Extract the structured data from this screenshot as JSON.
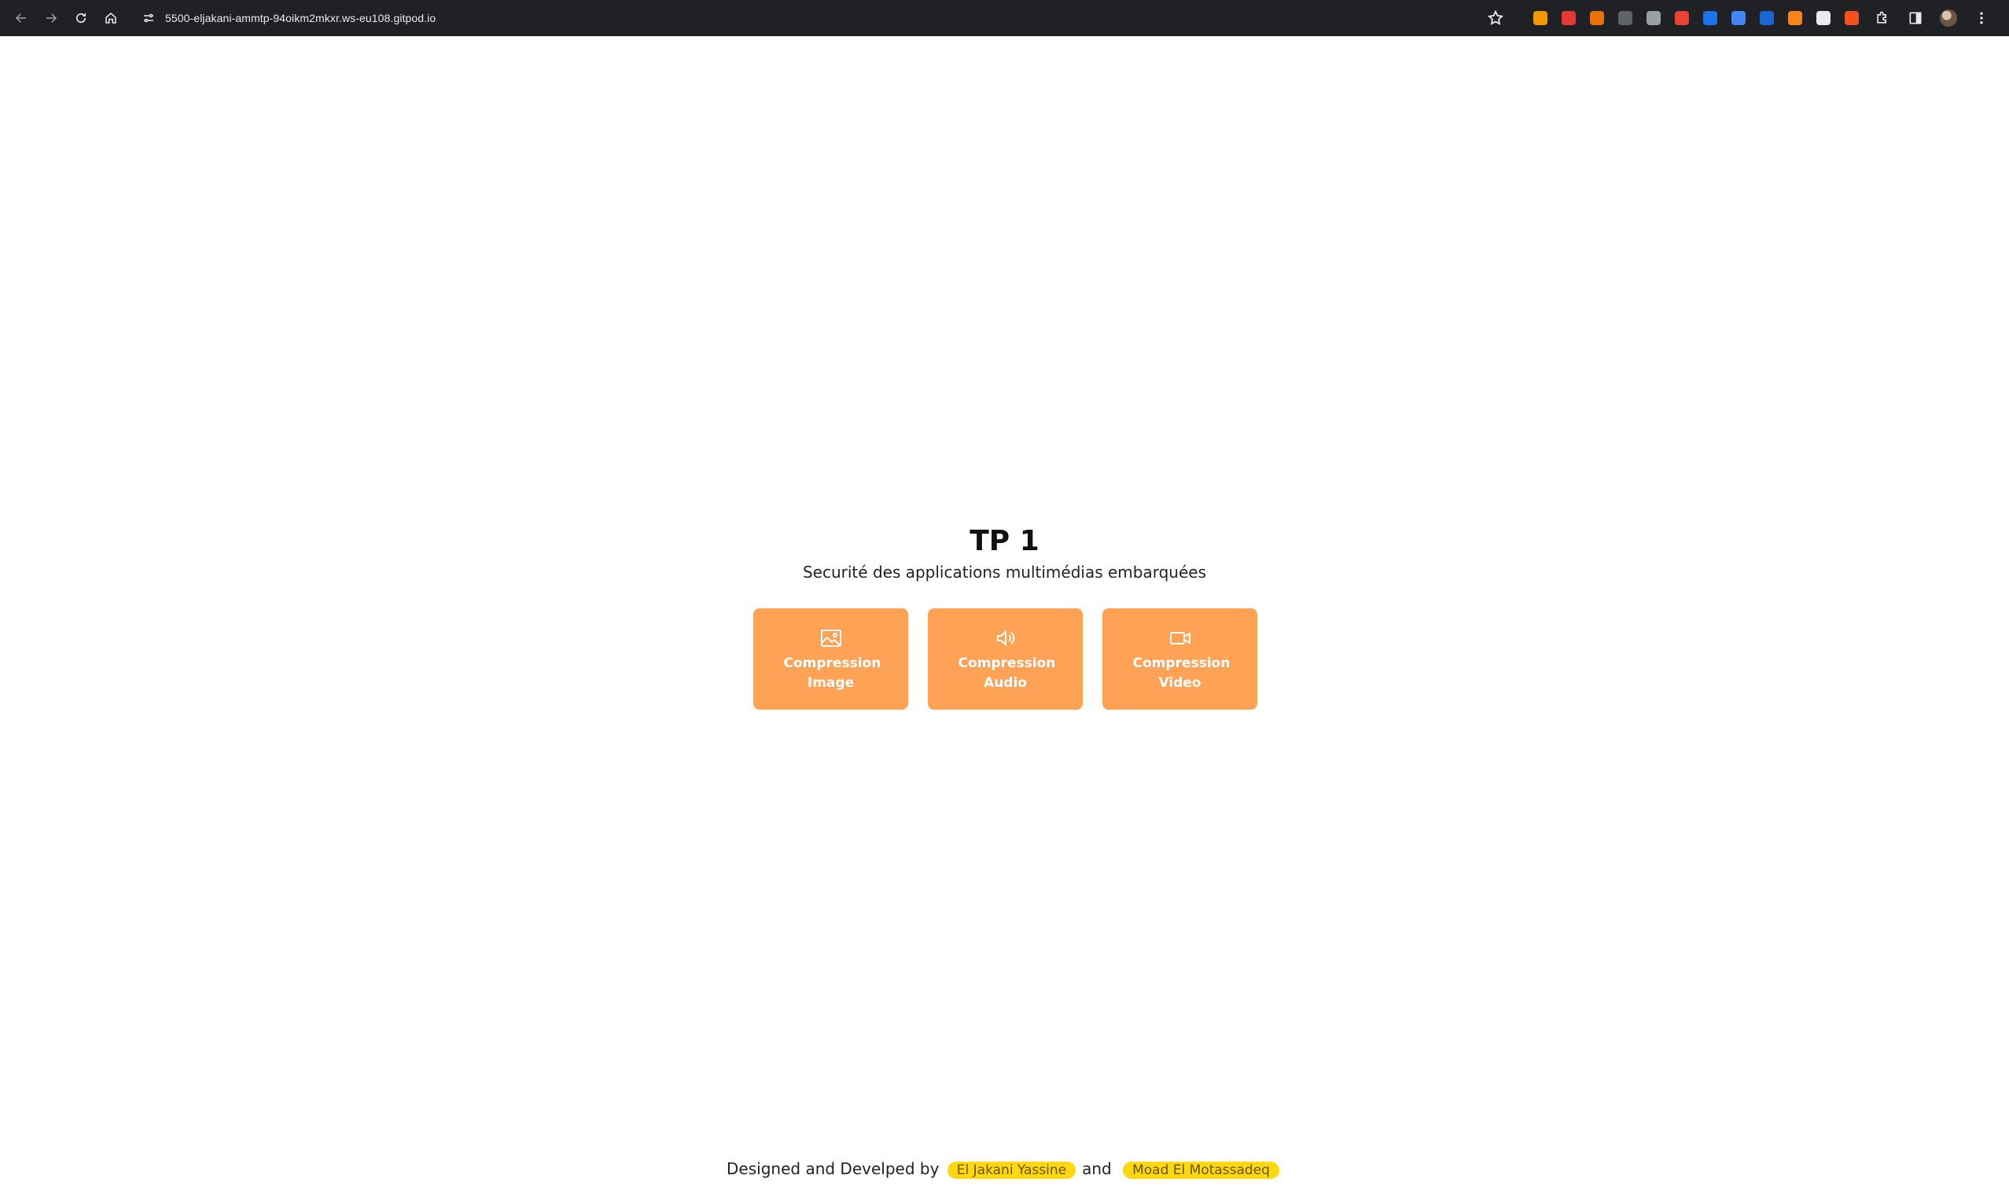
{
  "browser": {
    "url": "5500-eljakani-ammtp-94oikm2mkxr.ws-eu108.gitpod.io",
    "extensions": [
      {
        "name": "ext-orange-icon",
        "color": "#f29900"
      },
      {
        "name": "ext-red-icon",
        "color": "#e53935"
      },
      {
        "name": "ext-cookie-icon",
        "color": "#e8710a"
      },
      {
        "name": "ext-terminal-icon",
        "color": "#5f6368"
      },
      {
        "name": "ext-vue-icon",
        "color": "#9aa0a6"
      },
      {
        "name": "ext-percent-icon",
        "color": "#ea4335"
      },
      {
        "name": "ext-blue-p-icon",
        "color": "#1a73e8"
      },
      {
        "name": "ext-translate-icon",
        "color": "#4285f4"
      },
      {
        "name": "ext-docs-icon",
        "color": "#1967d2"
      },
      {
        "name": "ext-metamask-icon",
        "color": "#f6851b"
      },
      {
        "name": "ext-qr-icon",
        "color": "#e8eaed"
      },
      {
        "name": "ext-arrow-icon",
        "color": "#f4511e"
      }
    ]
  },
  "page": {
    "title": "TP 1",
    "subtitle": "Securité des applications multimédias embarquées",
    "cards": [
      {
        "icon": "image-icon",
        "label": "Compression Image"
      },
      {
        "icon": "speaker-icon",
        "label": "Compression Audio"
      },
      {
        "icon": "video-camera-icon",
        "label": "Compression Video"
      }
    ],
    "card_color": "#fea355",
    "footer": {
      "prefix": "Designed and Develped by",
      "author1": "El Jakani Yassine",
      "conjunction": "and",
      "author2": "Moad El Motassadeq",
      "badge_color": "#fdd80f"
    }
  }
}
